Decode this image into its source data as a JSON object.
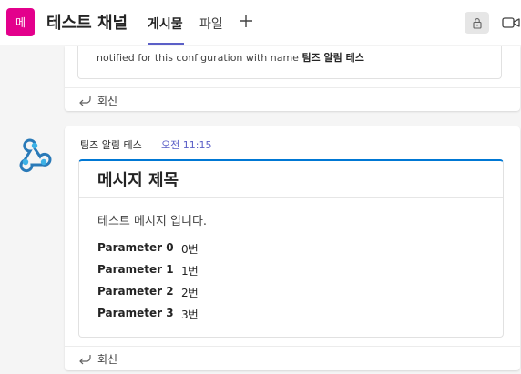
{
  "header": {
    "team_avatar_text": "메",
    "team_avatar_color": "#e3008c",
    "channel_title": "테스트 채널",
    "tabs": [
      {
        "label": "게시물",
        "active": true
      },
      {
        "label": "파일",
        "active": false
      }
    ],
    "add_tab_icon": "plus-icon",
    "lock_icon": "lock-icon",
    "video_icon": "video-camera-icon",
    "accent_color": "#5b5fc7"
  },
  "messages": [
    {
      "text_prefix": "notified for this configuration with name ",
      "text_bold": "팀즈 알림 테스",
      "reply_label": "회신"
    },
    {
      "sender": "팀즈 알림 테스",
      "time": "오전 11:15",
      "avatar_icon": "webhook-icon",
      "card": {
        "title": "메시지 제목",
        "body": "테스트 메시지 입니다.",
        "facts": [
          {
            "name": "Parameter 0",
            "value": "0번"
          },
          {
            "name": "Parameter 1",
            "value": "1번"
          },
          {
            "name": "Parameter 2",
            "value": "2번"
          },
          {
            "name": "Parameter 3",
            "value": "3번"
          }
        ],
        "accent_color": "#0078d4"
      },
      "reply_label": "회신"
    }
  ]
}
